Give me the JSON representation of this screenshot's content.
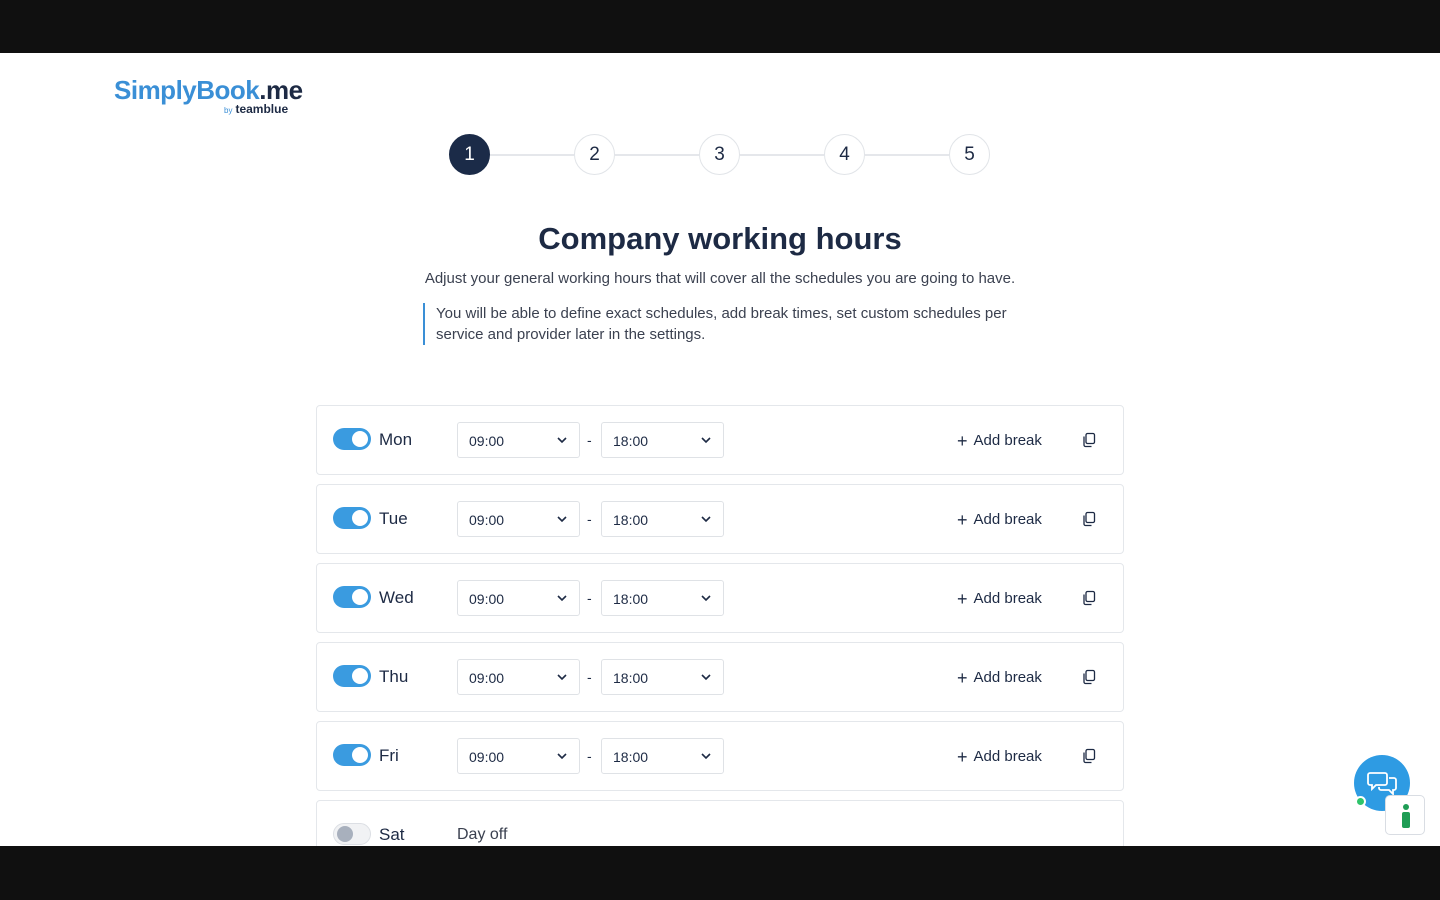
{
  "logo": {
    "main": "SimplyBook",
    "suffix": ".me",
    "by": "by",
    "brand": "teamblue"
  },
  "stepper": {
    "steps": [
      "1",
      "2",
      "3",
      "4",
      "5"
    ],
    "active": 1
  },
  "header": {
    "title": "Company working hours",
    "subtitle": "Adjust your general working hours that will cover all the schedules you are going to have.",
    "note": "You will be able to define exact schedules, add break times, set custom schedules per service and provider later in the settings."
  },
  "schedule": {
    "separator": "-",
    "add_break_label": "Add break",
    "days": [
      {
        "label": "Mon",
        "enabled": true,
        "start": "09:00",
        "end": "18:00"
      },
      {
        "label": "Tue",
        "enabled": true,
        "start": "09:00",
        "end": "18:00"
      },
      {
        "label": "Wed",
        "enabled": true,
        "start": "09:00",
        "end": "18:00"
      },
      {
        "label": "Thu",
        "enabled": true,
        "start": "09:00",
        "end": "18:00"
      },
      {
        "label": "Fri",
        "enabled": true,
        "start": "09:00",
        "end": "18:00"
      },
      {
        "label": "Sat",
        "enabled": false,
        "status": "Day off"
      }
    ]
  },
  "icons": {
    "chevron": "chevron-down-icon",
    "plus": "plus-icon",
    "copy": "copy-icon",
    "chat": "chat-icon",
    "helper": "accessibility-icon"
  },
  "colors": {
    "accent": "#3a9be0",
    "dark": "#1b2b48",
    "online": "#2ec46b"
  }
}
